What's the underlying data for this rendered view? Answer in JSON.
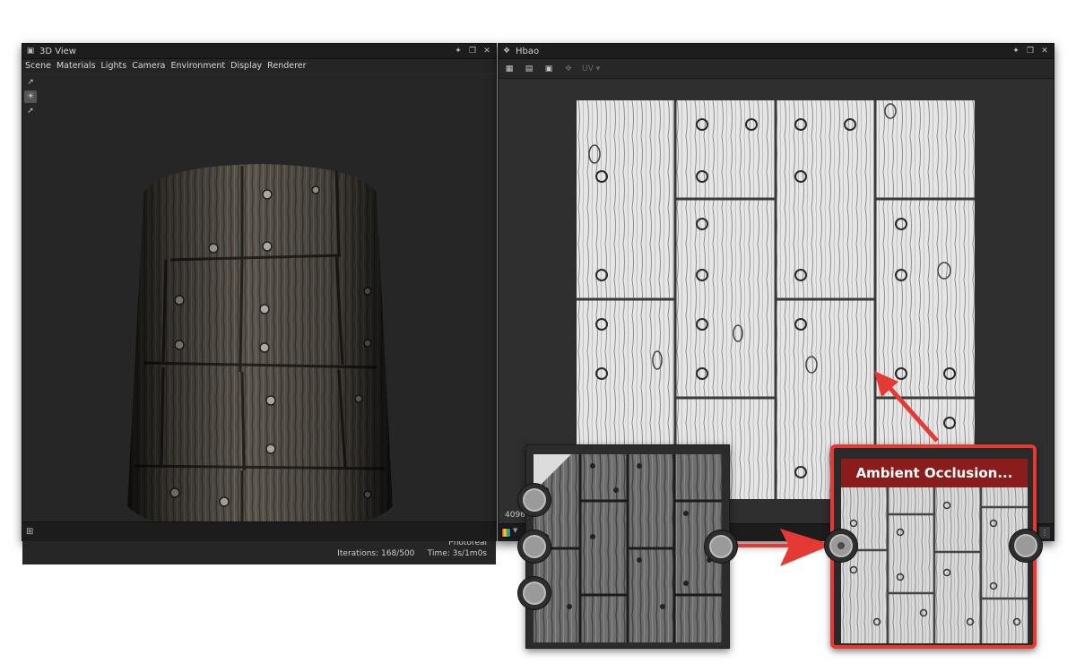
{
  "view3d": {
    "title": "3D View",
    "menu": [
      "Scene",
      "Materials",
      "Lights",
      "Camera",
      "Environment",
      "Display",
      "Renderer"
    ],
    "render_mode": "Photoreal",
    "iterations": "Iterations: 168/500",
    "time": "Time: 3s/1m0s"
  },
  "view2d": {
    "title": "Hbao",
    "uv_label": "UV",
    "resolution": "4096"
  },
  "graph": {
    "ao_node_title": "Ambient Occlusion..."
  },
  "colors": {
    "highlight_red": "#e53935",
    "node_header": "#8a1c1c",
    "panel_bg": "#2b2b2b"
  }
}
